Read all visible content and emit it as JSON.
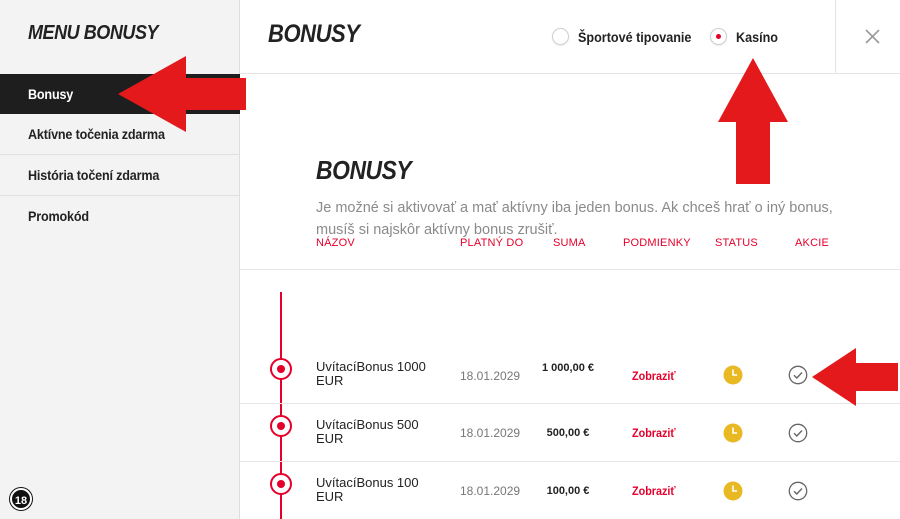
{
  "sidebar": {
    "title": "MENU BONUSY",
    "items": [
      {
        "label": "Bonusy",
        "active": true
      },
      {
        "label": "Aktívne točenia zdarma",
        "active": false
      },
      {
        "label": "História točení zdarma",
        "active": false
      },
      {
        "label": "Promokód",
        "active": false
      }
    ],
    "age_badge": "18"
  },
  "header": {
    "title": "BONUSY",
    "radios": [
      {
        "label": "Športové tipovanie",
        "checked": false
      },
      {
        "label": "Kasíno",
        "checked": true
      }
    ],
    "close_icon": "close-icon"
  },
  "main": {
    "title": "BONUSY",
    "description": "Je možné si aktivovať a mať aktívny iba jeden bonus. Ak chceš hrať o iný bonus, musíš si najskôr aktívny bonus zrušiť.",
    "table": {
      "headers": [
        "NÁZOV",
        "PLATNÝ DO",
        "SUMA",
        "PODMIENKY",
        "STATUS",
        "AKCIE"
      ],
      "rows": [
        {
          "name": "UvítacíBonus 1000 EUR",
          "date": "18.01.2029",
          "sum": "1 000,00 €",
          "conditions": "Zobraziť",
          "status_icon": "clock-icon",
          "action_icon": "check-icon"
        },
        {
          "name": "UvítacíBonus 500 EUR",
          "date": "18.01.2029",
          "sum": "500,00 €",
          "conditions": "Zobraziť",
          "status_icon": "clock-icon",
          "action_icon": "check-icon"
        },
        {
          "name": "UvítacíBonus 100 EUR",
          "date": "18.01.2029",
          "sum": "100,00 €",
          "conditions": "Zobraziť",
          "status_icon": "clock-icon",
          "action_icon": "check-icon"
        }
      ]
    }
  },
  "colors": {
    "accent": "#e4002b",
    "sidebar_bg": "#f3f3f3",
    "active_item_bg": "#1e1e1e",
    "status_yellow": "#e8b923",
    "arrow_red": "#e3191b"
  }
}
